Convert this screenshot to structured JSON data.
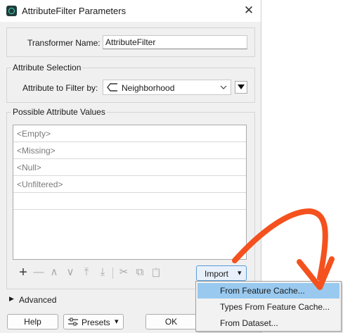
{
  "window": {
    "title": "AttributeFilter Parameters",
    "close_glyph": "✕"
  },
  "transformer": {
    "label": "Transformer Name:",
    "value": "AttributeFilter"
  },
  "attr_selection": {
    "group_label": "Attribute Selection",
    "label": "Attribute to Filter by:",
    "value": "Neighborhood",
    "attr_icon": "attribute-tag-icon"
  },
  "values_group": {
    "label": "Possible Attribute Values"
  },
  "values": [
    "<Empty>",
    "<Missing>",
    "<Null>",
    "<Unfiltered>"
  ],
  "toolbar": {
    "add": "+",
    "remove": "—",
    "up": "∧",
    "down": "∨",
    "top": "⤒",
    "bottom": "⤓",
    "cut": "✂",
    "copy": "⧉",
    "paste": "📋"
  },
  "import_button": {
    "label": "Import",
    "arrow": "▾"
  },
  "import_menu": {
    "items": [
      "From Feature Cache...",
      "Types From Feature Cache...",
      "From Dataset..."
    ],
    "highlighted_index": 0
  },
  "advanced": {
    "label": "Advanced",
    "caret": "▶"
  },
  "footer": {
    "help": "Help",
    "presets": "Presets",
    "presets_arrow": "▾",
    "ok": "OK"
  },
  "annotation": {
    "arrow_color": "#f4511e"
  }
}
